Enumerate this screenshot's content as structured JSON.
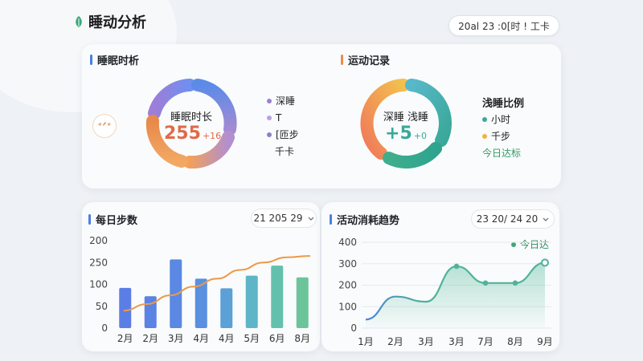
{
  "header": {
    "title": "睡动分析",
    "date_range": "20al 23 :0[时 ! 工卡"
  },
  "sleep_card": {
    "title": "睡眠时析",
    "accent": "#4a7fe0",
    "ring_label": "睡眠时长",
    "ring_value": "255",
    "ring_value_suffix": "+16",
    "ring_value_color": "#e06a4a",
    "legend": [
      {
        "label": "深睡",
        "color": "#9b7fd6"
      },
      {
        "label": "T",
        "color": "#b9a2df"
      },
      {
        "label": "[匝步",
        "color": "#8f7fc9"
      },
      {
        "label": "千卡",
        "color": null
      }
    ],
    "emoji_icon": "sleep-emoji-icon",
    "emoji_text": "⁺ᐟ⁺"
  },
  "activity_card": {
    "title": "运动记录",
    "accent": "#f08a4a",
    "ring_label": "深睡 浅睡",
    "ring_value": "+5",
    "ring_value_suffix": "+0",
    "ring_value_color": "#3aa899",
    "legend_title": "浅睡比例",
    "legend": [
      {
        "label": "小时",
        "color": "#3aa899"
      },
      {
        "label": "千步",
        "color": "#f0b33a"
      }
    ],
    "footer_label": "今日达标",
    "footer_color": "#2f9a66"
  },
  "steps_card": {
    "title": "每日步数",
    "accent": "#4a7fe0",
    "select_value": "21 205 29"
  },
  "trend_card": {
    "title": "活动消耗趋势",
    "accent": "#4a7fe0",
    "select_value": "23 20/ 24 20",
    "legend_label": "今日达"
  },
  "chart_data": [
    {
      "type": "bar",
      "chart": "每日步数",
      "categories": [
        "2月",
        "2月",
        "3月",
        "4月",
        "4月",
        "5月",
        "6月",
        "8月"
      ],
      "values": [
        92,
        73,
        157,
        113,
        91,
        120,
        143,
        116
      ],
      "ylim": [
        0,
        200
      ],
      "yticks": [
        0,
        50,
        100,
        150,
        200
      ],
      "ytick_labels": [
        "0",
        "50",
        "100",
        "250",
        "200"
      ],
      "trend_line": [
        40,
        55,
        75,
        95,
        113,
        133,
        150,
        162,
        165
      ],
      "grid": false,
      "bar_colors": [
        "#5b7ee6",
        "#5a83e4",
        "#5a88e3",
        "#5a90df",
        "#5ba0d6",
        "#5fb5c8",
        "#63c0ad",
        "#6cc49a"
      ],
      "trend_color": "#eb9a48"
    },
    {
      "type": "area",
      "chart": "活动消耗趋势",
      "categories": [
        "1月",
        "2月",
        "3月",
        "3月",
        "7月",
        "8月",
        "9月"
      ],
      "values": [
        40,
        147,
        123,
        288,
        210,
        210,
        305
      ],
      "markers": [
        false,
        false,
        false,
        true,
        true,
        true,
        true
      ],
      "ylim": [
        0,
        400
      ],
      "yticks": [
        0,
        100,
        200,
        300,
        400
      ],
      "grid": true,
      "line_color": "#4fb39a",
      "line_start_color": "#4e86d8"
    }
  ]
}
